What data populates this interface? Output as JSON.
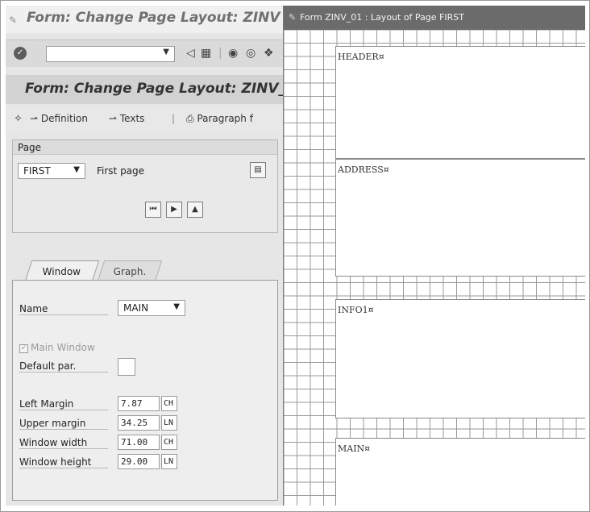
{
  "window_title": "Form: Change Page Layout: ZINV",
  "command_field": {
    "value": ""
  },
  "screen_title": "Form: Change Page Layout: ZINV_",
  "app_toolbar": {
    "definition_label": "Definition",
    "texts_label": "Texts",
    "paragraph_label": "Paragraph f"
  },
  "page_group": {
    "title": "Page",
    "page_value": "FIRST",
    "page_description": "First page"
  },
  "tabs": [
    {
      "label": "Window"
    },
    {
      "label": "Graph."
    }
  ],
  "window_tab": {
    "name_label": "Name",
    "name_value": "MAIN",
    "main_window_label": "Main Window",
    "default_par_label": "Default par.",
    "fields": [
      {
        "label": "Left Margin",
        "value": "7.87",
        "unit": "CH"
      },
      {
        "label": "Upper margin",
        "value": "34.25",
        "unit": "LN"
      },
      {
        "label": "Window width",
        "value": "71.00",
        "unit": "CH"
      },
      {
        "label": "Window height",
        "value": "29.00",
        "unit": "LN"
      }
    ]
  },
  "layout_window": {
    "title": "Form ZINV_01 : Layout of Page FIRST",
    "windows": [
      {
        "name": "HEADER¤"
      },
      {
        "name": "ADDRESS¤"
      },
      {
        "name": "INFO1¤"
      },
      {
        "name": "MAIN¤"
      }
    ]
  },
  "icons": [
    "enter-icon",
    "dropdown-icon",
    "back-icon",
    "save-icon",
    "exit-icon",
    "cancel-icon",
    "print-icon",
    "first-page-icon",
    "next-page-icon",
    "graphic-icon"
  ]
}
